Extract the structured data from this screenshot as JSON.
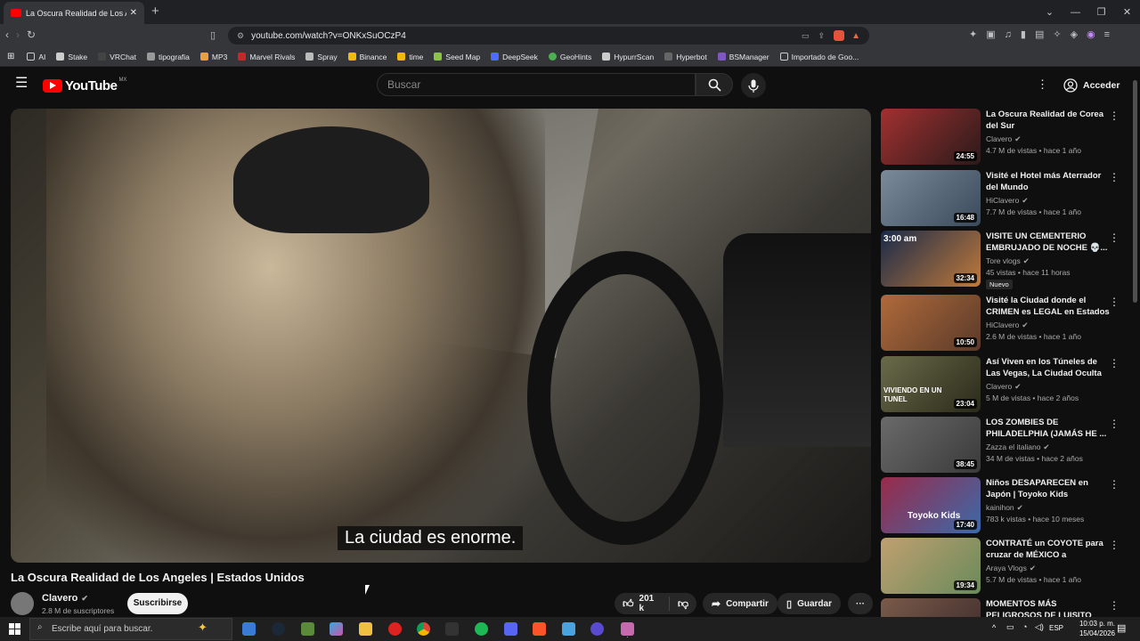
{
  "browser": {
    "tab_title": "La Oscura Realidad de Los Angeles | Estados Unidos",
    "new_tab": "+",
    "url": "youtube.com/watch?v=ONKxSuOCzP4",
    "bookmarks": [
      "AI",
      "Stake",
      "VRChat",
      "tipografia",
      "MP3",
      "Marvel Rivals",
      "Spray",
      "Binance",
      "time",
      "Seed Map",
      "DeepSeek",
      "GeoHints",
      "HypurrScan",
      "Hyperbot",
      "BSManager",
      "Importado de Goo..."
    ]
  },
  "header": {
    "logo": "YouTube",
    "region": "MX",
    "search_placeholder": "Buscar",
    "signin": "Acceder"
  },
  "video": {
    "caption": "La ciudad es enorme.",
    "title": "La Oscura Realidad de Los Angeles | Estados Unidos",
    "channel": "Clavero",
    "subscribers": "2.8 M de suscriptores",
    "subscribe": "Suscribirse",
    "likes": "201 k",
    "share": "Compartir",
    "save": "Guardar"
  },
  "sidebar": [
    {
      "title": "La Oscura Realidad de Corea del Sur",
      "channel": "Clavero",
      "meta": "4.7 M de vistas • hace 1 año",
      "duration": "24:55",
      "color": "#6b2a2a"
    },
    {
      "title": "Visité el Hotel más Aterrador del Mundo",
      "channel": "HiClavero",
      "meta": "7.7 M de vistas • hace 1 año",
      "duration": "16:48",
      "color": "#5a6a7a"
    },
    {
      "title": "VISITE UN CEMENTERIO EMBRUJADO DE NOCHE 💀... ...",
      "channel": "Tore vlogs",
      "meta": "45 vistas • hace 11 horas",
      "duration": "32:34",
      "color": "#1f3a5a",
      "overlay": "3:00 am",
      "badge": "Nuevo"
    },
    {
      "title": "Visité la Ciudad donde el CRIMEN es LEGAL en Estados ...",
      "channel": "HiClavero",
      "meta": "2.6 M de vistas • hace 1 año",
      "duration": "10:50",
      "color": "#8a5a2a"
    },
    {
      "title": "Así Viven en los Túneles de Las Vegas, La Ciudad Oculta",
      "channel": "Clavero",
      "meta": "5 M de vistas • hace 2 años",
      "duration": "23:04",
      "color": "#3a3a2a",
      "overlay2": "VIVIENDO EN UN TUNEL"
    },
    {
      "title": "LOS ZOMBIES DE PHILADELPHIA (JAMÁS HE ...",
      "channel": "Zazza el italiano",
      "meta": "34 M de vistas • hace 2 años",
      "duration": "38:45",
      "color": "#4a4a4a"
    },
    {
      "title": "Niños DESAPARECEN en Japón | Toyoko Kids",
      "channel": "kainihon",
      "meta": "783 k vistas • hace 10 meses",
      "duration": "17:40",
      "color": "#7a2a3a",
      "overlay3": "Toyoko Kids"
    },
    {
      "title": "CONTRATÉ un COYOTE para cruzar de MÉXICO a ESTADOS...",
      "channel": "Araya Vlogs",
      "meta": "5.7 M de vistas • hace 1 año",
      "duration": "19:34",
      "color": "#8a7a5a"
    },
    {
      "title": "MOMENTOS MÁS PELIGROSOS DE LUISITO COMUNICA",
      "channel": "",
      "meta": "",
      "duration": "",
      "color": "#5a4a3a"
    }
  ],
  "taskbar": {
    "search_placeholder": "Escribe aquí para buscar.",
    "lang": "ESP",
    "time": "10:03 p. m.",
    "date": "15/04/2026"
  }
}
